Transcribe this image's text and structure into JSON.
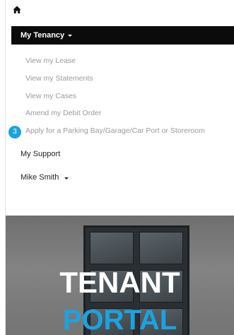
{
  "nav": {
    "home_icon": "home-icon",
    "tenancy_menu": {
      "label": "My Tenancy",
      "items": [
        "View my Lease",
        "View my Statements",
        "View my Cases",
        "Amend my Debit Order",
        "Apply for a Parking Bay/Garage/Car Port or Storeroom"
      ]
    },
    "support_label": "My Support",
    "user_menu_label": "Mike Smith"
  },
  "step_badge": "3",
  "hero": {
    "title_line1": "TENANT",
    "title_line2": "PORTAL"
  },
  "colors": {
    "menu_bar_bg": "#0b0b0b",
    "submenu_text": "#9a9a9a",
    "accent": "#1ba3e0"
  }
}
